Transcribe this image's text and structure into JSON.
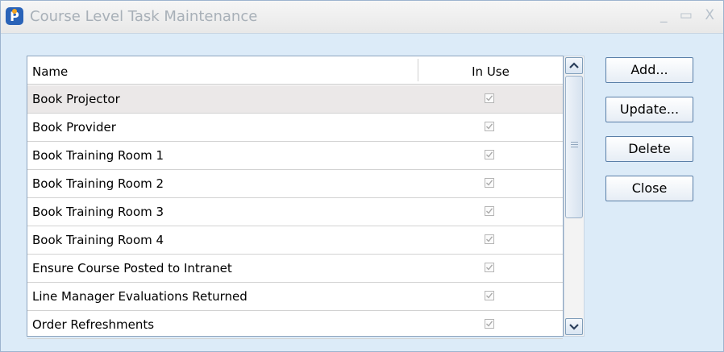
{
  "window": {
    "title": "Course Level Task Maintenance",
    "controls": "_ ▭ X"
  },
  "list": {
    "columns": {
      "name": "Name",
      "in_use": "In Use"
    },
    "rows": [
      {
        "name": "Book Projector",
        "in_use": true,
        "selected": true
      },
      {
        "name": "Book Provider",
        "in_use": true
      },
      {
        "name": "Book Training Room 1",
        "in_use": true
      },
      {
        "name": "Book Training Room 2",
        "in_use": true
      },
      {
        "name": "Book Training Room 3",
        "in_use": true
      },
      {
        "name": "Book Training Room 4",
        "in_use": true
      },
      {
        "name": "Ensure Course Posted to Intranet",
        "in_use": true
      },
      {
        "name": "Line Manager Evaluations Returned",
        "in_use": true
      },
      {
        "name": "Order Refreshments",
        "in_use": true
      }
    ]
  },
  "buttons": {
    "add": "Add...",
    "update": "Update...",
    "delete": "Delete",
    "close": "Close"
  },
  "icons": {
    "app": "app-logo-icon",
    "checkbox": "checkbox-checked-icon",
    "scroll_up": "chevron-up-icon",
    "scroll_down": "chevron-down-icon"
  }
}
